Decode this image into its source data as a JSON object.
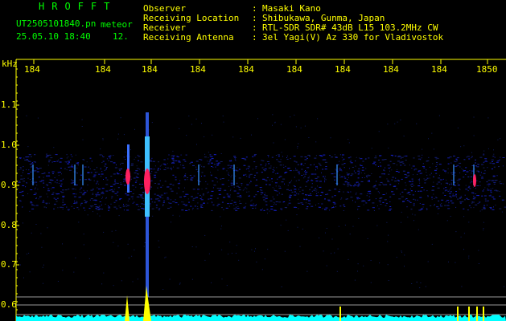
{
  "header": {
    "logo": "HROFFT",
    "filename": "UT2505101840.pn",
    "meteor_label": "meteor",
    "datetime": "25.05.10 18:40",
    "count": "12.",
    "info": [
      {
        "key": "Observer",
        "sep": ":",
        "value": "Masaki Kano"
      },
      {
        "key": "Receiving Location",
        "sep": ":",
        "value": "Shibukawa, Gunma, Japan"
      },
      {
        "key": "Receiver",
        "sep": ":",
        "value": "RTL-SDR SDR# 43dB L15 103.2MHz CW"
      },
      {
        "key": "Receiving Antenna",
        "sep": ":",
        "value": "3el Yagi(V) Az 330 for Vladivostok"
      }
    ]
  },
  "spectrogram": {
    "y_unit": "kHz",
    "y_ticks": [
      "1.1",
      "1.0",
      "0.9",
      "0.8",
      "0.7",
      "0.6"
    ],
    "time_ticks": [
      "184",
      "184",
      "184",
      "184",
      "184",
      "184",
      "184",
      "184",
      "184",
      "1850"
    ],
    "colors": {
      "text": "#ffff00",
      "logo": "#00ff00",
      "echo": "#ff2060",
      "noise": "#1a2f8f",
      "baseline": "#00ffff",
      "spike": "#ffff00"
    }
  }
}
